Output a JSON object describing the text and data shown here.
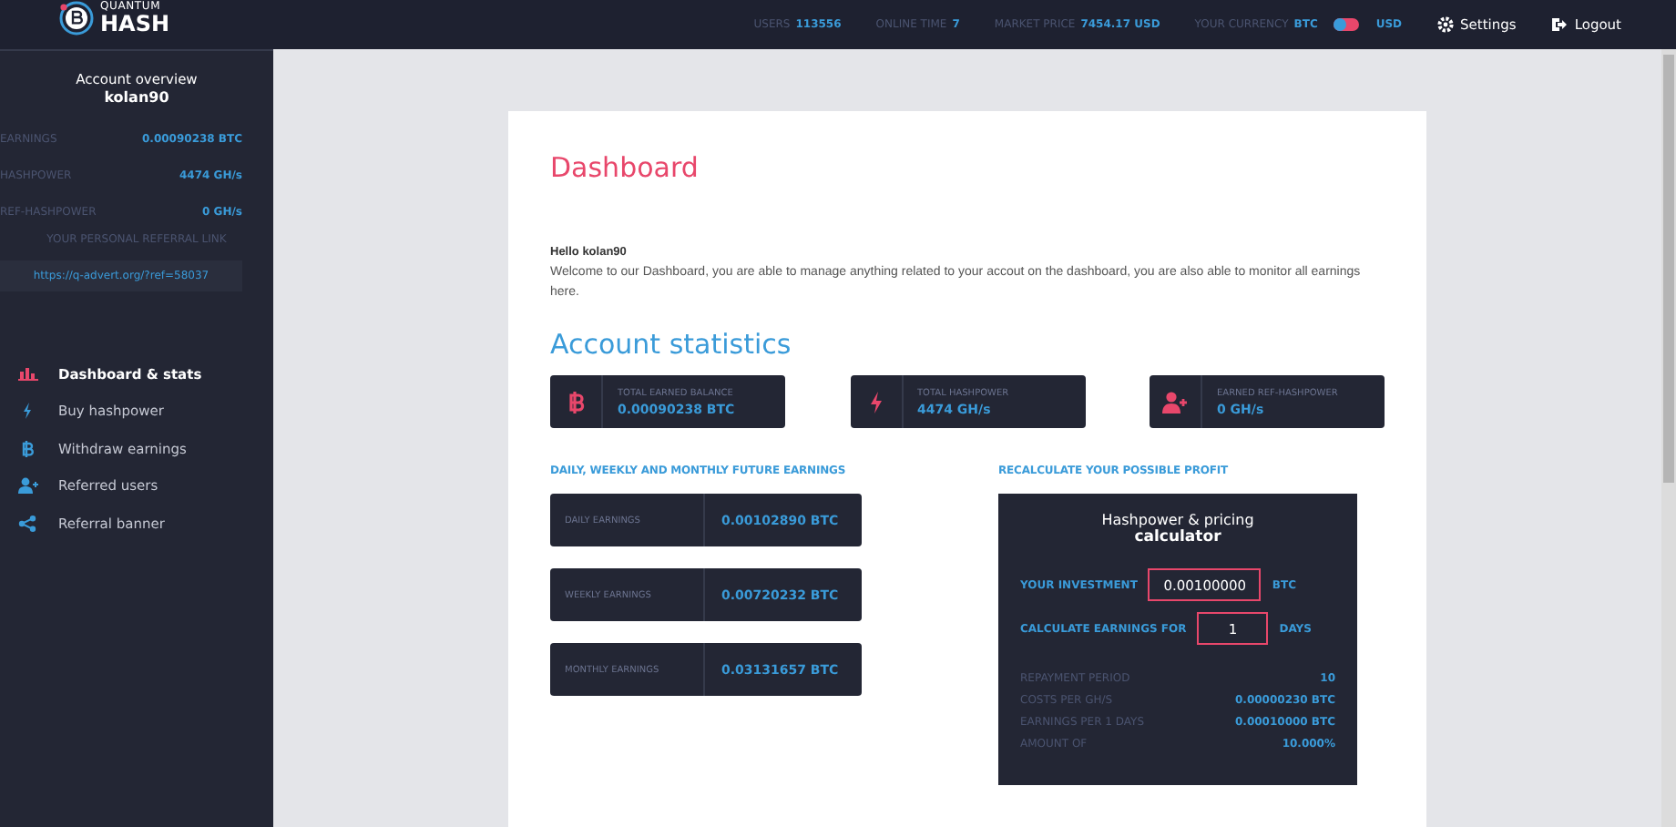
{
  "logo": {
    "top": "QUANTUM",
    "bottom": "HASH"
  },
  "topbar": {
    "stats": [
      {
        "label": "USERS",
        "value": "113556"
      },
      {
        "label": "ONLINE TIME",
        "value": "7"
      },
      {
        "label": "MARKET PRICE",
        "value": "7454.17 USD"
      }
    ],
    "currency": {
      "label": "YOUR CURRENCY",
      "left_option": "BTC",
      "right_option": "USD",
      "on": false
    },
    "links": [
      "Settings",
      "Logout"
    ]
  },
  "sidebar": {
    "title": "Account overview",
    "username": "kolan90",
    "rows": [
      {
        "label": "EARNINGS",
        "value": "0.00090238 BTC"
      },
      {
        "label": "HASHPOWER",
        "value": "4474 GH/s"
      },
      {
        "label": "REF-HASHPOWER",
        "value": "0 GH/s"
      }
    ],
    "referral_label": "YOUR PERSONAL REFERRAL LINK",
    "referral_link": "https://q-advert.org/?ref=58037",
    "items": [
      {
        "label": "Dashboard & stats",
        "selected": true
      },
      {
        "label": "Buy hashpower",
        "selected": false
      },
      {
        "label": "Withdraw earnings",
        "selected": false
      },
      {
        "label": "Referred users",
        "selected": false
      },
      {
        "label": "Referral banner",
        "selected": false
      }
    ]
  },
  "main": {
    "title": "Dashboard",
    "greeting": "Hello kolan90",
    "intro": "Welcome to our Dashboard, you are able to manage anything related to your accout on the dashboard, you are also able to monitor all earnings here.",
    "stats_title": "Account statistics",
    "stats": [
      {
        "label": "TOTAL EARNED BALANCE",
        "value": "0.00090238 BTC"
      },
      {
        "label": "TOTAL HASHPOWER",
        "value": "4474 GH/s"
      },
      {
        "label": "EARNED REF-HASHPOWER",
        "value": "0 GH/s"
      }
    ],
    "earnings_title": "DAILY, WEEKLY AND MONTHLY FUTURE EARNINGS",
    "earnings": [
      {
        "label": "DAILY EARNINGS",
        "value": "0.00102890 BTC"
      },
      {
        "label": "WEEKLY EARNINGS",
        "value": "0.00720232 BTC"
      },
      {
        "label": "MONTHLY EARNINGS",
        "value": "0.03131657 BTC"
      }
    ],
    "calculator_title": "RECALCULATE YOUR POSSIBLE PROFIT",
    "calculator": {
      "heading": "Hashpower & pricing",
      "subheading": "calculator",
      "fields": [
        {
          "label": "YOUR INVESTMENT",
          "value": "0.00100000",
          "unit": "BTC"
        },
        {
          "label": "CALCULATE EARNINGS FOR",
          "value": "1",
          "unit": "DAYS"
        }
      ],
      "results": [
        {
          "label": "REPAYMENT PERIOD",
          "value": "10"
        },
        {
          "label": "COSTS PER GH/S",
          "value": "0.00000230 BTC"
        },
        {
          "label": "EARNINGS PER 1 DAYS",
          "value": "0.00010000 BTC"
        },
        {
          "label": "AMOUNT OF",
          "value": "10.000%"
        }
      ]
    }
  }
}
